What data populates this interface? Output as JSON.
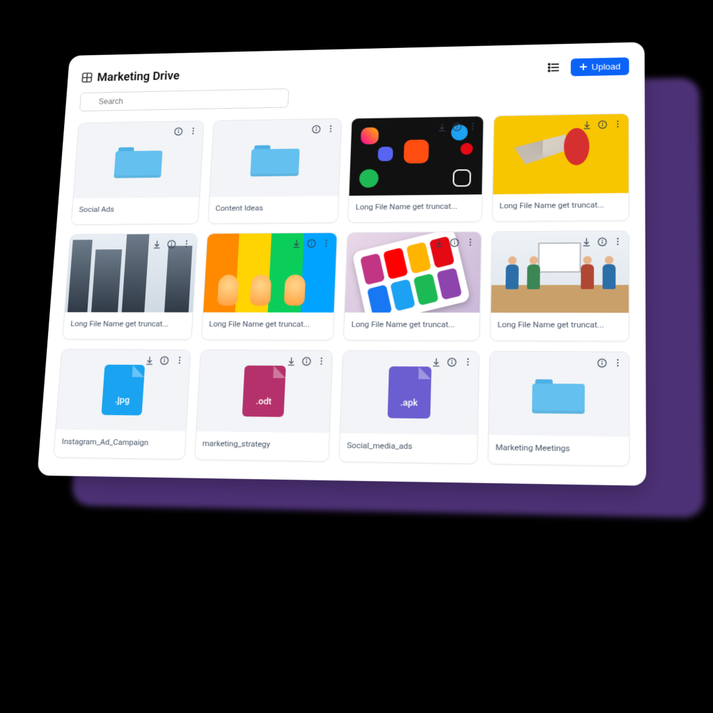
{
  "header": {
    "title": "Marketing Drive",
    "upload_label": "Upload",
    "search_placeholder": "Search"
  },
  "items": [
    {
      "name": "Social Ads",
      "kind": "folder",
      "actions": [
        "info",
        "more"
      ]
    },
    {
      "name": "Content Ideas",
      "kind": "folder",
      "actions": [
        "info",
        "more"
      ]
    },
    {
      "name": "Long File Name get truncat...",
      "kind": "image",
      "thumb": "apps",
      "actions": [
        "download",
        "info",
        "more"
      ]
    },
    {
      "name": "Long File Name get truncat...",
      "kind": "image",
      "thumb": "mega",
      "actions": [
        "download",
        "info",
        "more"
      ]
    },
    {
      "name": "Long File Name get truncat...",
      "kind": "image",
      "thumb": "city",
      "actions": [
        "download",
        "info",
        "more"
      ]
    },
    {
      "name": "Long File Name get truncat...",
      "kind": "image",
      "thumb": "bulb",
      "actions": [
        "download",
        "info",
        "more"
      ]
    },
    {
      "name": "Long File Name get truncat...",
      "kind": "image",
      "thumb": "phone",
      "actions": [
        "download",
        "info",
        "more"
      ]
    },
    {
      "name": "Long File Name get truncat...",
      "kind": "image",
      "thumb": "meet",
      "actions": [
        "download",
        "info",
        "more"
      ]
    },
    {
      "name": "Instagram_Ad_Campaign",
      "kind": "file",
      "ext": ".jpg",
      "cls": "jpg",
      "actions": [
        "download",
        "info",
        "more"
      ]
    },
    {
      "name": "marketing_strategy",
      "kind": "file",
      "ext": ".odt",
      "cls": "odt",
      "actions": [
        "download",
        "info",
        "more"
      ]
    },
    {
      "name": "Social_media_ads",
      "kind": "file",
      "ext": ".apk",
      "cls": "apk",
      "actions": [
        "download",
        "info",
        "more"
      ]
    },
    {
      "name": "Marketing Meetings",
      "kind": "folder",
      "actions": [
        "info",
        "more"
      ]
    }
  ]
}
